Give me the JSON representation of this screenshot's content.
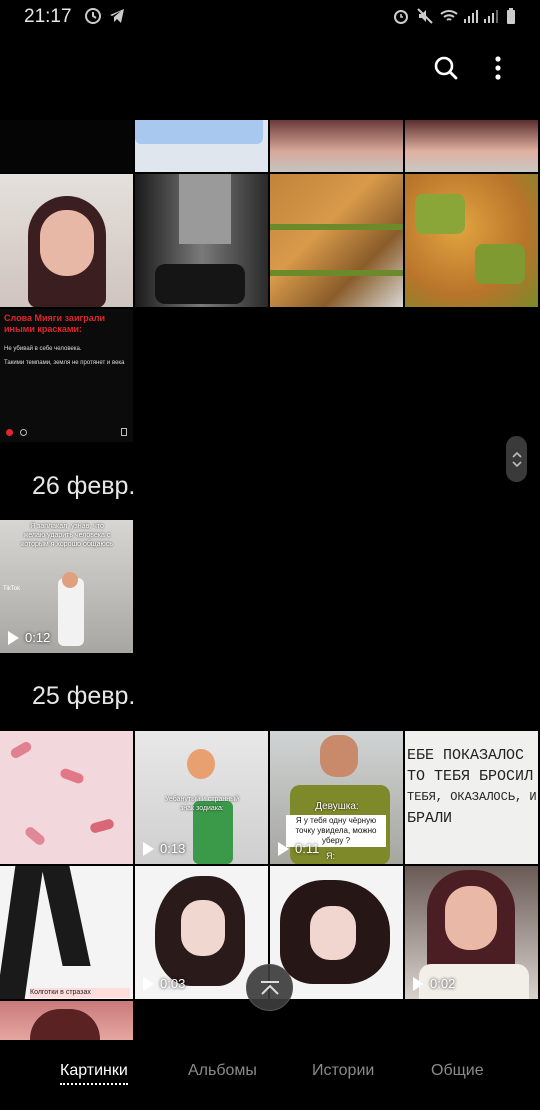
{
  "status_bar": {
    "time": "21:17"
  },
  "sections": [
    {
      "date": "26 февр.",
      "videos": [
        {
          "duration": "0:12"
        }
      ]
    },
    {
      "date": "25 февр.",
      "videos": [
        {
          "duration": "0:13"
        },
        {
          "duration": "0:11"
        },
        {
          "duration": "0:03"
        },
        {
          "duration": "0:02"
        }
      ]
    }
  ],
  "post_card": {
    "title": "Слова Мияги заиграли иными красками:",
    "line1": "Не убивай в себе человека.",
    "line2": "Такими темпами, земля не протянет и века"
  },
  "video_captions": {
    "v1": "Я заплакал, узнав, что желаю ударить человека с которым я хорошо общаюсь",
    "v2": "Уебанутый и странный знак зодиака:",
    "v3_title": "Девушка:",
    "v3_bubble": "Я у тебя одну чёрную точку увидела, можно уберу ?",
    "v3_tail": "Я:",
    "tiktok": "TikTok"
  },
  "note_text": [
    "ЕБЕ ПОКАЗАЛОС",
    "ТО ТЕБЯ БРОСИЛ",
    "ТЕБЯ, ОКАЗАЛОСЬ, И",
    "БРАЛИ"
  ],
  "tights_caption": "Колготки в стразах",
  "tabs": [
    {
      "label": "Картинки",
      "active": true
    },
    {
      "label": "Альбомы",
      "active": false
    },
    {
      "label": "Истории",
      "active": false
    },
    {
      "label": "Общие",
      "active": false
    }
  ],
  "icons": {
    "search": "search-icon",
    "more": "more-vert-icon",
    "to_top": "arrow-up-to-top-icon"
  }
}
